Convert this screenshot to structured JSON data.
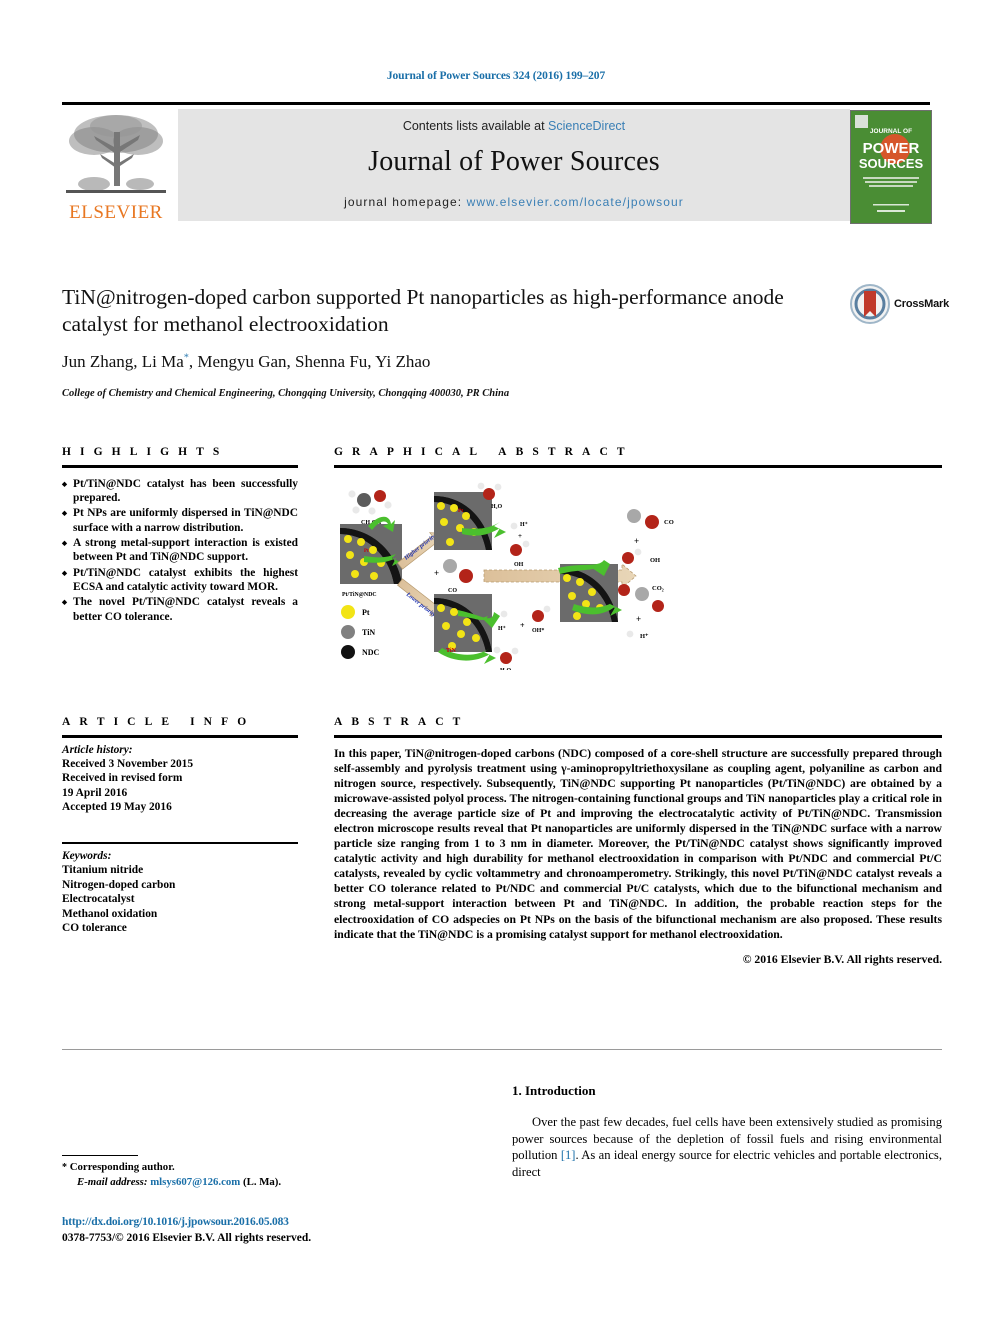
{
  "running_head": "Journal of Power Sources 324 (2016) 199–207",
  "masthead": {
    "contents_prefix": "Contents lists available at ",
    "sciencedirect": "ScienceDirect",
    "journal_name": "Journal of Power Sources",
    "homepage_prefix": "journal homepage: ",
    "homepage_url": "www.elsevier.com/locate/jpowsour",
    "publisher": "ELSEVIER",
    "cover": {
      "line1": "JOURNAL OF",
      "line2": "POWER",
      "line3": "SOURCES",
      "blurb": "International journal on the Science and Technology of Electrochemical Energy Systems",
      "footer": "ScienceDirect"
    },
    "colors": {
      "link": "#3a7fb5",
      "elsevier_orange": "#E87722",
      "band_grey": "#e4e4e4",
      "cover_green": "#4a8d34"
    }
  },
  "article": {
    "title": "TiN@nitrogen-doped carbon supported Pt nanoparticles as high-performance anode catalyst for methanol electrooxidation",
    "authors": "Jun Zhang, Li Ma",
    "authors_after_mark": ", Mengyu Gan, Shenna Fu, Yi Zhao",
    "corresponding_mark": "*",
    "affiliation": "College of Chemistry and Chemical Engineering, Chongqing University, Chongqing 400030, PR China",
    "crossmark_label": "CrossMark"
  },
  "highlights": {
    "heading": "HIGHLIGHTS",
    "items": [
      "Pt/TiN@NDC catalyst has been successfully prepared.",
      "Pt NPs are uniformly dispersed in TiN@NDC surface with a narrow distribution.",
      "A strong metal-support interaction is existed between Pt and TiN@NDC support.",
      "Pt/TiN@NDC catalyst exhibits the highest ECSA and catalytic activity toward MOR.",
      "The novel Pt/TiN@NDC catalyst reveals a better CO tolerance."
    ]
  },
  "graphical_abstract": {
    "heading": "GRAPHICAL ABSTRACT",
    "labels": {
      "methanol": "CH3OH",
      "catalyst": "Pt/TiN@NDC",
      "pt_site": "Pt",
      "tin_site": "TiN",
      "water": "H2O",
      "proton": "H+",
      "hydroxide": "OH",
      "hydroxide_ads": "OH*",
      "co": "CO",
      "co2": "CO2",
      "arrow_fast": "Higher priority",
      "arrow_slow": "Lower priority",
      "plus": "+"
    },
    "legend": [
      {
        "name": "Pt",
        "color": "#f2e416"
      },
      {
        "name": "TiN",
        "color": "#808080"
      },
      {
        "name": "NDC",
        "color": "#111111"
      }
    ]
  },
  "article_info": {
    "heading": "ARTICLE INFO",
    "history_label": "Article history:",
    "history": [
      "Received 3 November 2015",
      "Received in revised form",
      "19 April 2016",
      "Accepted 19 May 2016"
    ],
    "keywords_label": "Keywords:",
    "keywords": [
      "Titanium nitride",
      "Nitrogen-doped carbon",
      "Electrocatalyst",
      "Methanol oxidation",
      "CO tolerance"
    ]
  },
  "abstract": {
    "heading": "ABSTRACT",
    "text": "In this paper, TiN@nitrogen-doped carbons (NDC) composed of a core-shell structure are successfully prepared through self-assembly and pyrolysis treatment using γ-aminopropyltriethoxysilane as coupling agent, polyaniline as carbon and nitrogen source, respectively. Subsequently, TiN@NDC supporting Pt nanoparticles (Pt/TiN@NDC) are obtained by a microwave-assisted polyol process. The nitrogen-containing functional groups and TiN nanoparticles play a critical role in decreasing the average particle size of Pt and improving the electrocatalytic activity of Pt/TiN@NDC. Transmission electron microscope results reveal that Pt nanoparticles are uniformly dispersed in the TiN@NDC surface with a narrow particle size ranging from 1 to 3 nm in diameter. Moreover, the Pt/TiN@NDC catalyst shows significantly improved catalytic activity and high durability for methanol electrooxidation in comparison with Pt/NDC and commercial Pt/C catalysts, revealed by cyclic voltammetry and chronoamperometry. Strikingly, this novel Pt/TiN@NDC catalyst reveals a better CO tolerance related to Pt/NDC and commercial Pt/C catalysts, which due to the bifunctional mechanism and strong metal-support interaction between Pt and TiN@NDC. In addition, the probable reaction steps for the electrooxidation of CO adspecies on Pt NPs on the basis of the bifunctional mechanism are also proposed. These results indicate that the TiN@NDC is a promising catalyst support for methanol electrooxidation.",
    "copyright": "© 2016 Elsevier B.V. All rights reserved."
  },
  "introduction": {
    "heading": "1. Introduction",
    "paragraph_part1": "Over the past few decades, fuel cells have been extensively studied as promising power sources because of the depletion of fossil fuels and rising environmental pollution ",
    "citation": "[1]",
    "paragraph_part2": ". As an ideal energy source for electric vehicles and portable electronics, direct"
  },
  "footer": {
    "corresponding_star": "*",
    "corresponding_label": "Corresponding author.",
    "email_label": "E-mail address:",
    "email": "mlsys607@126.com",
    "email_suffix": "(L. Ma).",
    "doi": "http://dx.doi.org/10.1016/j.jpowsour.2016.05.083",
    "issn": "0378-7753/© 2016 Elsevier B.V. All rights reserved."
  }
}
